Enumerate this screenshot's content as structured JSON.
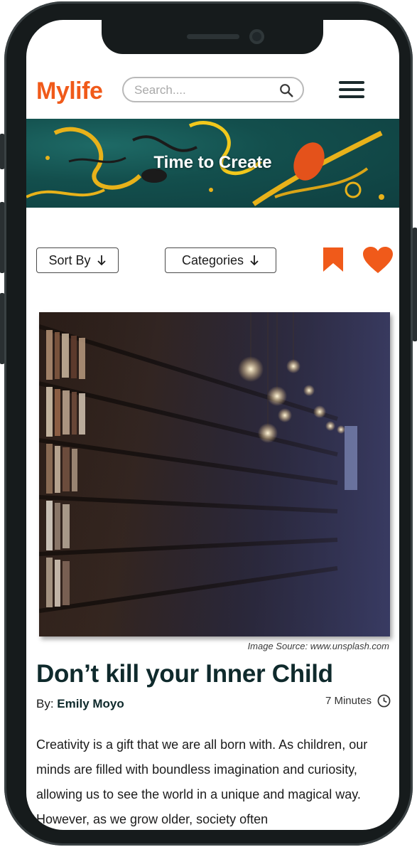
{
  "header": {
    "logo": "Mylife",
    "search_placeholder": "Search...."
  },
  "banner": {
    "title": "Time to Create"
  },
  "filters": {
    "sort_label": "Sort By",
    "categories_label": "Categories"
  },
  "article": {
    "image_source": "Image Source: www.unsplash.com",
    "title": "Don’t kill your Inner Child",
    "by_label": "By:",
    "author": "Emily Moyo",
    "read_time": "7 Minutes",
    "body": "Creativity is a gift that we are all born with. As children, our minds are filled with boundless imagination and curiosity, allowing us to see the world in a unique and magical way. However, as we grow older, society often"
  },
  "colors": {
    "brand": "#f05a1a",
    "dark_teal": "#0f2a2c",
    "frame": "#161b1c"
  },
  "icons": [
    "search-icon",
    "menu-icon",
    "arrow-down-icon",
    "bookmark-icon",
    "heart-icon",
    "clock-icon"
  ]
}
